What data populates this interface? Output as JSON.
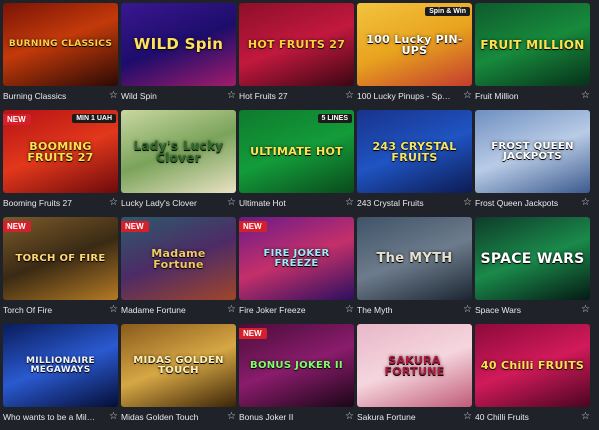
{
  "games": [
    {
      "name": "Burning Classics",
      "art": "BURNING CLASSICS",
      "bg": "linear-gradient(160deg,#7a1407,#c33a0a 45%,#2b0a05)",
      "fg": "#ffd24a",
      "size": 9,
      "badge": "",
      "corner": ""
    },
    {
      "name": "Wild Spin",
      "art": "WILD Spin",
      "bg": "linear-gradient(160deg,#3a1790,#1d0d6b 50%,#a21c6b)",
      "fg": "#ffe25a",
      "size": 15,
      "badge": "",
      "corner": ""
    },
    {
      "name": "Hot Fruits 27",
      "art": "HOT FRUITS 27",
      "bg": "linear-gradient(160deg,#8d0f2a,#c2183e 50%,#3a0712)",
      "fg": "#ffcf3d",
      "size": 11,
      "badge": "",
      "corner": ""
    },
    {
      "name": "100 Lucky Pinups - Sp…",
      "art": "100 Lucky PIN-UPS",
      "bg": "linear-gradient(160deg,#f3c33e,#e8a31e 50%,#c43b2e)",
      "fg": "#ffffff",
      "size": 11,
      "badge": "",
      "corner": "Spin & Win"
    },
    {
      "name": "Fruit Million",
      "art": "FRUIT MILLION",
      "bg": "linear-gradient(160deg,#0e5b2c,#178a3c 50%,#07301a)",
      "fg": "#ffe04d",
      "size": 12,
      "badge": "",
      "corner": ""
    },
    {
      "name": "Booming Fruits 27",
      "art": "BOOMING FRUITS 27",
      "bg": "linear-gradient(160deg,#b51216,#e2381b 50%,#6d0a0d)",
      "fg": "#ffe04d",
      "size": 11,
      "badge": "NEW",
      "corner": "MIN 1 UAH"
    },
    {
      "name": "Lucky Lady's Clover",
      "art": "Lady's Lucky Clover",
      "bg": "linear-gradient(160deg,#c9d7a0,#7aa35a 50%,#e9e2c4)",
      "fg": "#2f6b2a",
      "size": 12,
      "badge": "",
      "corner": ""
    },
    {
      "name": "Ultimate Hot",
      "art": "ULTIMATE HOT",
      "bg": "linear-gradient(160deg,#0f7a2e,#139c3a 50%,#0a4a1c)",
      "fg": "#ffe34f",
      "size": 11,
      "badge": "",
      "corner": "5 LINES"
    },
    {
      "name": "243 Crystal Fruits",
      "art": "243 CRYSTAL FRUITS",
      "bg": "linear-gradient(160deg,#18338c,#1f54c2 50%,#0d1b52)",
      "fg": "#f6e46a",
      "size": 11,
      "badge": "",
      "corner": ""
    },
    {
      "name": "Frost Queen Jackpots",
      "art": "FROST QUEEN JACKPOTS",
      "bg": "linear-gradient(160deg,#6f8fc0,#b9cce6 50%,#3c5a8e)",
      "fg": "#ffffff",
      "size": 10,
      "badge": "",
      "corner": ""
    },
    {
      "name": "Torch Of Fire",
      "art": "TORCH OF FIRE",
      "bg": "linear-gradient(160deg,#7b5a2a,#3a2a14 50%,#b57a24)",
      "fg": "#ffd777",
      "size": 10,
      "badge": "NEW",
      "corner": ""
    },
    {
      "name": "Madame Fortune",
      "art": "Madame Fortune",
      "bg": "linear-gradient(160deg,#2d5a6c,#4d2b66 50%,#a0462a)",
      "fg": "#f0c865",
      "size": 11,
      "badge": "NEW",
      "corner": ""
    },
    {
      "name": "Fire Joker Freeze",
      "art": "FIRE JOKER FREEZE",
      "bg": "linear-gradient(160deg,#6a1a8a,#c4306a 50%,#2b1060)",
      "fg": "#9ee8ff",
      "size": 10,
      "badge": "NEW",
      "corner": ""
    },
    {
      "name": "The Myth",
      "art": "The MYTH",
      "bg": "linear-gradient(160deg,#3f5268,#6d7c8c 50%,#1c2632)",
      "fg": "#e6e0cf",
      "size": 13,
      "badge": "",
      "corner": ""
    },
    {
      "name": "Space Wars",
      "art": "SPACE WARS",
      "bg": "linear-gradient(160deg,#0e3b2a,#1a8a4a 50%,#051a14)",
      "fg": "#ffffff",
      "size": 14,
      "badge": "",
      "corner": ""
    },
    {
      "name": "Who wants to be a Mil…",
      "art": "MILLIONAIRE MEGAWAYS",
      "bg": "linear-gradient(160deg,#0a1c5c,#2a5ad0 50%,#050d35)",
      "fg": "#f0f4ff",
      "size": 9,
      "badge": "",
      "corner": ""
    },
    {
      "name": "Midas Golden Touch",
      "art": "MIDAS GOLDEN TOUCH",
      "bg": "linear-gradient(160deg,#8a5b1c,#d6a744 50%,#3b2408)",
      "fg": "#fff0b8",
      "size": 10,
      "badge": "",
      "corner": ""
    },
    {
      "name": "Bonus Joker II",
      "art": "BONUS JOKER II",
      "bg": "linear-gradient(160deg,#4a0d3a,#8a1c6c 50%,#1a0616)",
      "fg": "#7dff6a",
      "size": 10,
      "badge": "NEW",
      "corner": ""
    },
    {
      "name": "Sakura Fortune",
      "art": "SAKURA FORTUNE",
      "bg": "linear-gradient(160deg,#e8b7c8,#f5d6de 50%,#c05a78)",
      "fg": "#b2173d",
      "size": 11,
      "badge": "",
      "corner": ""
    },
    {
      "name": "40 Chilli Fruits",
      "art": "40 Chilli FRUITS",
      "bg": "linear-gradient(160deg,#8c0a3a,#d11a5a 50%,#4a0520)",
      "fg": "#ffe04d",
      "size": 11,
      "badge": "",
      "corner": ""
    }
  ]
}
